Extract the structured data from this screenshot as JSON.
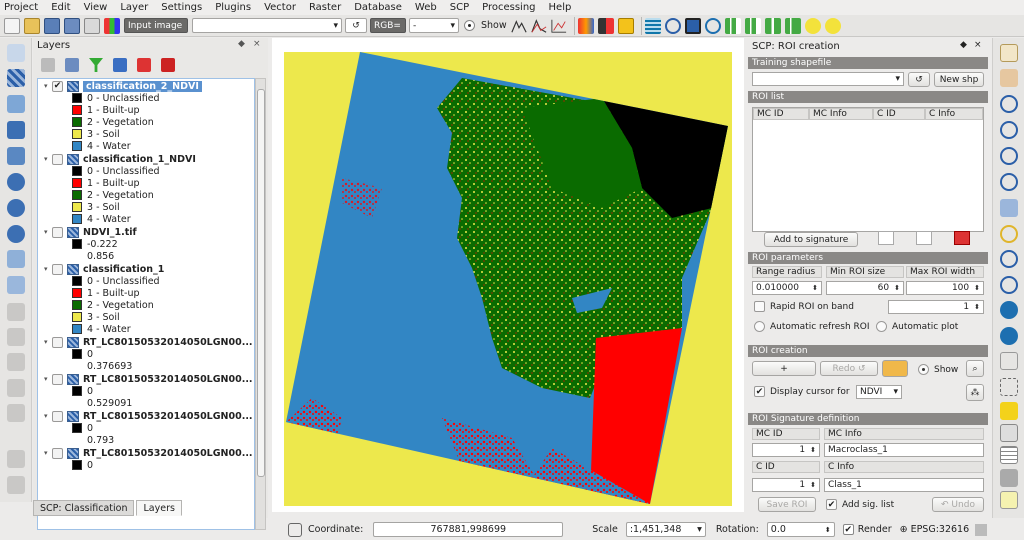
{
  "menu": [
    "Project",
    "Edit",
    "View",
    "Layer",
    "Settings",
    "Plugins",
    "Vector",
    "Raster",
    "Database",
    "Web",
    "SCP",
    "Processing",
    "Help"
  ],
  "toolbar": {
    "input_image_label": "Input image",
    "rgb_label": "RGB=",
    "rgb_value": "-",
    "show_label": "Show"
  },
  "layers_panel": {
    "title": "Layers",
    "float_glyph": "◆",
    "close_glyph": "×",
    "groups": [
      {
        "name": "classification_2_NDVI",
        "checked": true,
        "selected": true,
        "items": [
          {
            "label": "0 - Unclassified",
            "color": "#000000"
          },
          {
            "label": "1 - Built-up",
            "color": "#ff0000"
          },
          {
            "label": "2 - Vegetation",
            "color": "#0a6b00"
          },
          {
            "label": "3 - Soil",
            "color": "#ede84c"
          },
          {
            "label": "4 - Water",
            "color": "#3286c4"
          }
        ]
      },
      {
        "name": "classification_1_NDVI",
        "checked": false,
        "selected": false,
        "items": [
          {
            "label": "0 - Unclassified",
            "color": "#000000"
          },
          {
            "label": "1 - Built-up",
            "color": "#ff0000"
          },
          {
            "label": "2 - Vegetation",
            "color": "#0a6b00"
          },
          {
            "label": "3 - Soil",
            "color": "#ede84c"
          },
          {
            "label": "4 - Water",
            "color": "#3286c4"
          }
        ]
      },
      {
        "name": "NDVI_1.tif",
        "checked": false,
        "selected": false,
        "items": [
          {
            "label": "-0.222",
            "color": "#000000"
          },
          {
            "label": "0.856",
            "color": null
          }
        ]
      },
      {
        "name": "classification_1",
        "checked": false,
        "selected": false,
        "items": [
          {
            "label": "0 - Unclassified",
            "color": "#000000"
          },
          {
            "label": "1 - Built-up",
            "color": "#ff0000"
          },
          {
            "label": "2 - Vegetation",
            "color": "#0a6b00"
          },
          {
            "label": "3 - Soil",
            "color": "#ede84c"
          },
          {
            "label": "4 - Water",
            "color": "#3286c4"
          }
        ]
      },
      {
        "name": "RT_LC80150532014050LGN00...",
        "checked": false,
        "selected": false,
        "items": [
          {
            "label": "0",
            "color": "#000000"
          },
          {
            "label": "0.376693",
            "color": null
          }
        ]
      },
      {
        "name": "RT_LC80150532014050LGN00...",
        "checked": false,
        "selected": false,
        "items": [
          {
            "label": "0",
            "color": "#000000"
          },
          {
            "label": "0.529091",
            "color": null
          }
        ]
      },
      {
        "name": "RT_LC80150532014050LGN00...",
        "checked": false,
        "selected": false,
        "items": [
          {
            "label": "0",
            "color": "#000000"
          },
          {
            "label": "0.793",
            "color": null
          }
        ]
      },
      {
        "name": "RT_LC80150532014050LGN00...",
        "checked": false,
        "selected": false,
        "items": [
          {
            "label": "0",
            "color": "#000000"
          }
        ]
      }
    ]
  },
  "bottom_tabs": [
    "SCP: Classification",
    "Layers"
  ],
  "scp": {
    "title": "SCP: ROI creation",
    "training_shapefile": "Training shapefile",
    "refresh_glyph": "↺",
    "new_shp": "New shp",
    "roi_list": "ROI list",
    "roi_columns": [
      "MC ID",
      "MC Info",
      "C ID",
      "C Info"
    ],
    "add_to_signature": "Add to signature",
    "roi_parameters": "ROI parameters",
    "range_radius_label": "Range radius",
    "min_roi_size_label": "Min ROI size",
    "max_roi_width_label": "Max ROI width",
    "range_radius": "0.010000",
    "min_roi_size": "60",
    "max_roi_width": "100",
    "rapid_roi_label": "Rapid ROI on band",
    "rapid_roi_band": "1",
    "auto_refresh_label": "Automatic refresh ROI",
    "auto_plot_label": "Automatic  plot",
    "roi_creation": "ROI creation",
    "plus": "+",
    "redo": "Redo ↺",
    "show_label": "Show",
    "display_cursor_label": "Display cursor for",
    "display_cursor_value": "NDVI",
    "roi_signature_def": "ROI Signature definition",
    "mc_id_label": "MC ID",
    "mc_info_label": "MC Info",
    "mc_id": "1",
    "mc_info": "Macroclass_1",
    "c_id_label": "C ID",
    "c_info_label": "C Info",
    "c_id": "1",
    "c_info": "Class_1",
    "save_roi": "Save ROI",
    "add_sig_list": "Add sig. list",
    "undo": "↶ Undo"
  },
  "status": {
    "coordinate_label": "Coordinate:",
    "coordinate": "767881,998699",
    "scale_label": "Scale",
    "scale": ":1,451,348",
    "rotation_label": "Rotation:",
    "rotation": "0.0",
    "render_label": "Render",
    "crs": "EPSG:32616"
  },
  "colors": {
    "unclassified": "#000000",
    "builtup": "#ff0000",
    "vegetation": "#0a6b00",
    "soil": "#ede84c",
    "water": "#3286c4",
    "selection": "#5a91cf"
  }
}
